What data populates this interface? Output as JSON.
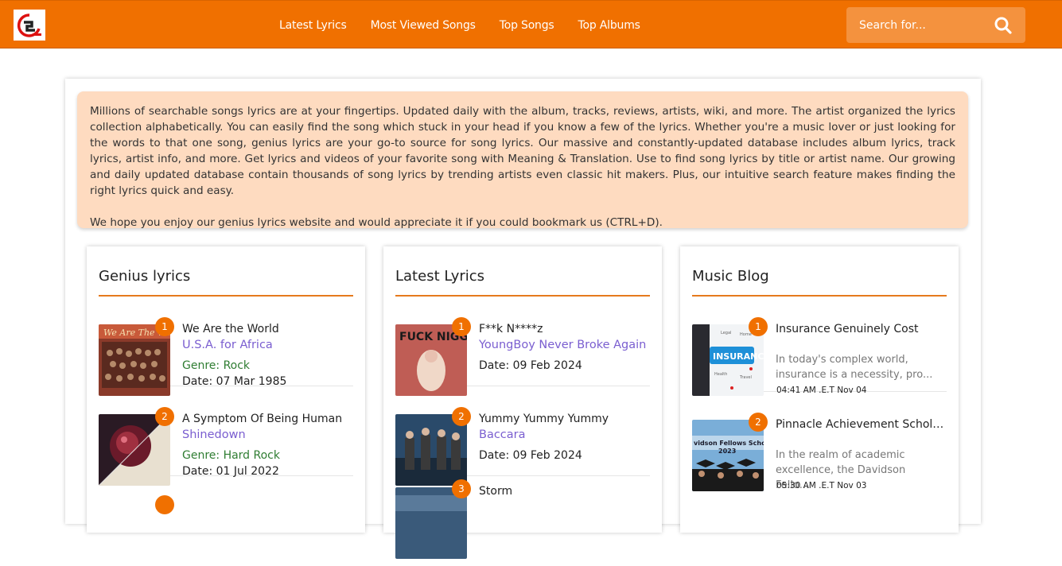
{
  "header": {
    "nav": [
      "Latest Lyrics",
      "Most Viewed Songs",
      "Top Songs",
      "Top Albums"
    ],
    "search_placeholder": "Search for...",
    "brand_color": "#f07000"
  },
  "intro": {
    "paragraph1": "Millions of searchable songs lyrics are at your fingertips. Updated daily with the album, tracks, reviews, artists, wiki, and more. The artist organized the lyrics collection alphabetically. You can easily find the song which stuck in your head if you know a few of the lyrics. Whether you're a music lover or just looking for the words to that one song, genius lyrics are your go-to source for song lyrics. Our massive and constantly-updated database includes album lyrics, track lyrics, artist info, and more. Get lyrics and videos of your favorite song with Meaning & Translation. Use to find song lyrics by title or artist name. Our growing and daily updated database contain thousands of song lyrics by trending artists even classic hit makers. Plus, our intuitive search feature makes finding the right lyrics quick and easy.",
    "paragraph2": "We hope you enjoy our genius lyrics website and would appreciate it if you could bookmark us (CTRL+D)."
  },
  "genius": {
    "title": "Genius lyrics",
    "items": [
      {
        "rank": "1",
        "song": "We Are the World",
        "artist": "U.S.A. for Africa",
        "genre": "Genre: Rock",
        "date": "Date: 07 Mar 1985"
      },
      {
        "rank": "2",
        "song": "A Symptom Of Being Human",
        "artist": "Shinedown",
        "genre": "Genre: Hard Rock",
        "date": "Date: 01 Jul 2022"
      }
    ]
  },
  "latest": {
    "title": "Latest Lyrics",
    "items": [
      {
        "rank": "1",
        "song": "F**k N****z",
        "artist": "YoungBoy Never Broke Again",
        "date": "Date: 09 Feb 2024"
      },
      {
        "rank": "2",
        "song": "Yummy Yummy Yummy",
        "artist": "Baccara",
        "date": "Date: 09 Feb 2024"
      },
      {
        "rank": "3",
        "song": "Storm"
      }
    ]
  },
  "blog": {
    "title": "Music Blog",
    "items": [
      {
        "rank": "1",
        "title": "Insurance Genuinely Cost",
        "excerpt": "In today's complex world, insurance is a necessity, pro...",
        "time": "04:41 AM .E.T Nov 04"
      },
      {
        "rank": "2",
        "title": "Pinnacle Achievement Scholars...",
        "excerpt": "In the realm of academic excellence, the Davidson Fello...",
        "time": "05:30 AM .E.T Nov 03"
      }
    ]
  }
}
